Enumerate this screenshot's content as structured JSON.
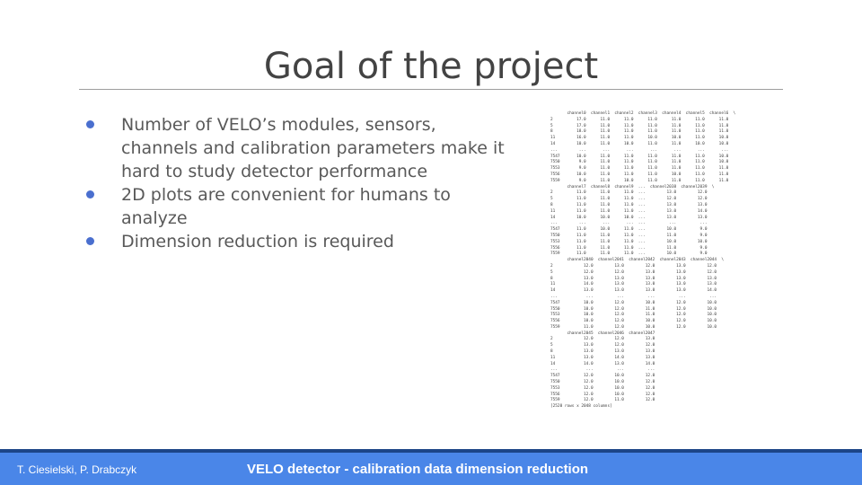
{
  "slide": {
    "title": "Goal of the project",
    "bullets": [
      "Number of VELO’s modules, sensors, channels and calibration parameters make it hard to study detector performance",
      "2D plots are convenient for humans to analyze",
      "Dimension reduction is required"
    ]
  },
  "dataframe": {
    "block1": "       channel0  channel1  channel2  channel3  channel4  channel5  channel6  \\\n2          17.0      11.0      11.0      11.0      11.0      11.0      11.0\n5          17.0      11.0      11.0      11.0      11.0      11.0      11.0\n8          18.0      11.0      11.0      11.0      11.0      11.0      11.0\n11         16.0      11.0      11.0      10.0      10.0      11.0      10.0\n14         10.0      11.0      10.0      11.0      11.0      10.0      10.0\n...         ...       ...       ...       ...       ...       ...       ...\n7547       10.0      11.0      11.0      11.0      11.0      11.0      10.0\n7550        9.0      11.0      11.0      11.0      11.0      11.0      10.0\n7553        9.0      11.0      11.0      11.0      11.0      11.0      11.0\n7556       10.0      11.0      11.0      11.0      10.0      11.0      11.0\n7559        9.0      11.0      10.0      11.0      11.0      11.0      11.0",
    "block2": "       channel7  channel8  channel9  ...  channel2038  channel2039  \\\n2          11.0      11.0      11.0  ...         13.0         12.0\n5          11.0      11.0      11.0  ...         12.0         12.0\n8          11.0      11.0      11.0  ...         13.0         13.0\n11         11.0      11.0      11.0  ...         13.0         14.0\n14         10.0      10.0      10.0  ...         13.0         13.0\n...         ...       ...       ...  ...          ...          ...\n7547       11.0      10.0      11.0  ...         10.0          9.0\n7550       11.0      11.0      11.0  ...         11.0          9.0\n7553       11.0      11.0      11.0  ...         10.0         10.0\n7556       11.0      11.0      11.0  ...         11.0          9.0\n7559       11.0      11.0      11.0  ...         10.0          9.0",
    "block3": "       channel2040  channel2041  channel2042  channel2043  channel2044  \\\n2             12.0         13.0         12.0         13.0         12.0\n5             12.0         12.0         13.0         13.0         12.0\n8             13.0         13.0         13.0         13.0         13.0\n11            14.0         13.0         13.0         13.0         13.0\n14            13.0         13.0         13.0         13.0         14.0\n...            ...          ...          ...          ...          ...\n7547          10.0         12.0         10.0         12.0         10.0\n7550          10.0         12.0         11.0         12.0         10.0\n7553          10.0         12.0         11.0         12.0         10.0\n7556          10.0         12.0         10.0         12.0         10.0\n7559          11.0         12.0         10.0         12.0         10.0",
    "block4": "       channel2045  channel2046  channel2047\n2             12.0         12.0         13.0\n5             13.0         12.0         12.0\n8             13.0         13.0         13.0\n11            13.0         14.0         13.0\n14            14.0         13.0         14.0\n...            ...          ...          ...\n7547          12.0         10.0         12.0\n7550          12.0         10.0         12.0\n7553          12.0         10.0         12.0\n7556          12.0         10.0         12.0\n7559          12.0         11.0         12.0",
    "shape": "[2520 rows x 2048 columns]"
  },
  "footer": {
    "authors": "T. Ciesielski, P. Drabczyk",
    "subtitle": "VELO detector - calibration data dimension reduction"
  },
  "colors": {
    "bullet": "#4a6fcf",
    "footer_bar": "#4a86e8",
    "footer_stripe": "#1c4587",
    "title": "#434343"
  }
}
